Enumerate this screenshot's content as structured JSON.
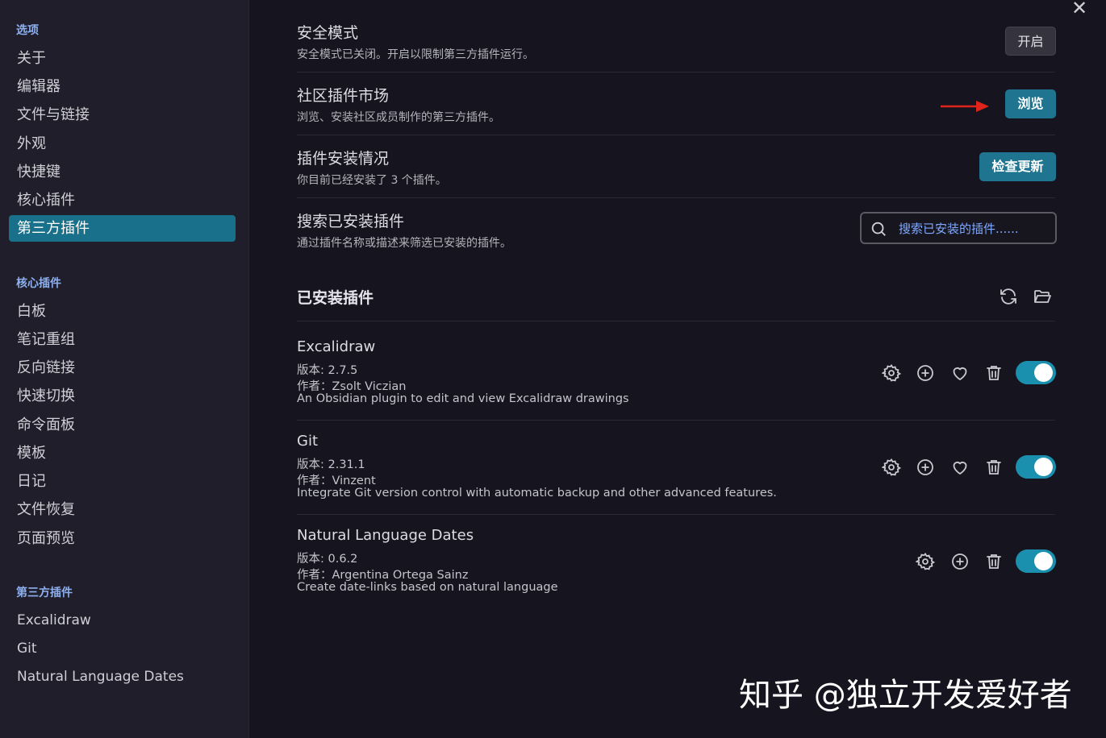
{
  "sidebar": {
    "sections": [
      {
        "title": "选项",
        "items": [
          "关于",
          "编辑器",
          "文件与链接",
          "外观",
          "快捷键",
          "核心插件",
          "第三方插件"
        ]
      },
      {
        "title": "核心插件",
        "items": [
          "白板",
          "笔记重组",
          "反向链接",
          "快速切换",
          "命令面板",
          "模板",
          "日记",
          "文件恢复",
          "页面预览"
        ]
      },
      {
        "title": "第三方插件",
        "items": [
          "Excalidraw",
          "Git",
          "Natural Language Dates"
        ]
      }
    ],
    "active_item": "第三方插件"
  },
  "settings": [
    {
      "name": "安全模式",
      "desc": "安全模式已关闭。开启以限制第三方插件运行。",
      "button": "开启"
    },
    {
      "name": "社区插件市场",
      "desc": "浏览、安装社区成员制作的第三方插件。",
      "button": "浏览"
    },
    {
      "name": "插件安装情况",
      "desc": "你目前已经安装了 3 个插件。",
      "button": "检查更新"
    },
    {
      "name": "搜索已安装插件",
      "desc": "通过插件名称或描述来筛选已安装的插件。",
      "search_placeholder": "搜索已安装的插件......"
    }
  ],
  "installed_heading": "已安装插件",
  "plugins": [
    {
      "name": "Excalidraw",
      "version": "版本: 2.7.5",
      "author": "作者：Zsolt Viczian",
      "description": "An Obsidian plugin to edit and view Excalidraw drawings",
      "enabled": true
    },
    {
      "name": "Git",
      "version": "版本: 2.31.1",
      "author": "作者：Vinzent",
      "description": "Integrate Git version control with automatic backup and other advanced features.",
      "enabled": true
    },
    {
      "name": "Natural Language Dates",
      "version": "版本: 0.6.2",
      "author": "作者：Argentina Ortega Sainz",
      "description": "Create date-links based on natural language",
      "enabled": true
    }
  ],
  "watermark": "知乎 @独立开发爱好者",
  "colors": {
    "accent": "#18708a",
    "toggle_on": "#1a8fae",
    "arrow": "#e0241c",
    "section_title": "#8fb0f0"
  }
}
